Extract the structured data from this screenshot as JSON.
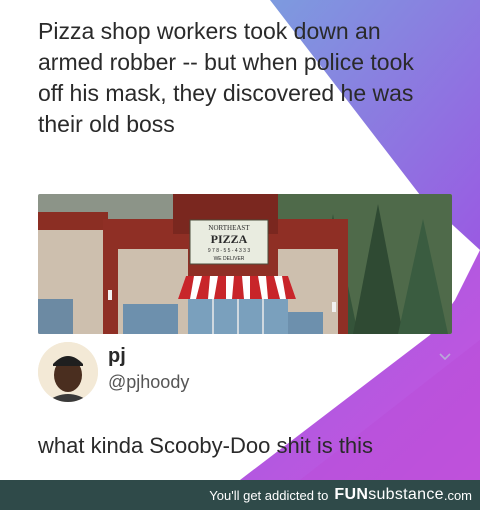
{
  "post": {
    "headline": "Pizza shop workers took down an\narmed robber -- but when police took\noff his mask, they discovered he was\ntheir old boss",
    "photo_sign": {
      "line1": "NORTHEAST",
      "line2": "PIZZA",
      "line3": "9 7 8 - 5 5 - 4 3 3 3",
      "line4": "WE DELIVER"
    }
  },
  "tweet": {
    "author_name": "pj",
    "author_handle": "@pjhoody",
    "text": "what kinda Scooby-Doo shit is this"
  },
  "footer": {
    "tagline": "You'll get addicted to",
    "brand_bold": "FUN",
    "brand_light": "substance",
    "domain": ".com"
  },
  "colors": {
    "purple": "#8f58e0",
    "magenta": "#c44fe0",
    "footer_bg": "#2f4a49"
  },
  "icons": {
    "menu": "chevron-down-icon"
  }
}
